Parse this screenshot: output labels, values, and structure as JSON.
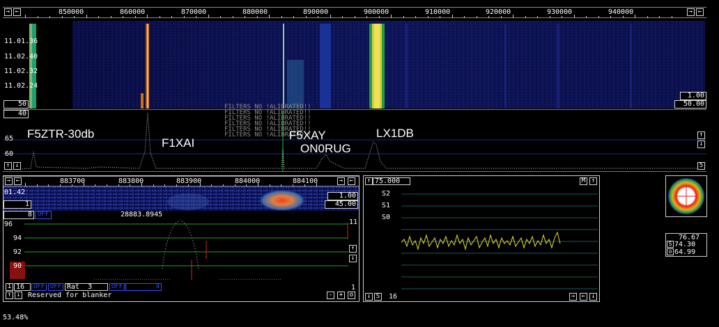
{
  "main_ruler": {
    "freqs": [
      "850000",
      "860000",
      "870000",
      "880000",
      "890000",
      "900000",
      "910000",
      "920000",
      "930000",
      "940000"
    ]
  },
  "waterfall": {
    "times": [
      "11.01.36",
      "11.02.40",
      "11.02.32",
      "11.02.24"
    ],
    "avg_box": "50",
    "gain_box": "1.00",
    "scale_box": "50.00",
    "filters_text": [
      "FILTERS NO",
      "FILTERS NO",
      "FILTERS NO",
      "FILTERS NO",
      "FILTERS NO",
      "FILTERS NO"
    ],
    "calib_text": [
      "!ALIBRATED!!",
      "!ALIBRATED!!",
      "!ALIBRATED!!",
      "!ALIBRATED!!",
      "!ALIBRATED!!",
      "!ALIBRATED!!"
    ]
  },
  "spectrum": {
    "top_box": "40",
    "ylabels": [
      "65",
      "60"
    ],
    "stations": [
      "F5ZTR-30db",
      "F1XAI",
      "F5XAY",
      "ON0RUG",
      "LX1DB"
    ],
    "side_box": "5"
  },
  "baseband": {
    "ruler_freqs": [
      "883700",
      "883800",
      "883900",
      "884000",
      "884100"
    ],
    "time_label": "01.42",
    "box_1": "1",
    "box_8": "8",
    "gain_box": "1.00",
    "scale_box": "45.00",
    "freq_readout": "28883.8945",
    "ylabels": [
      "96",
      "94",
      "92",
      "90"
    ],
    "right_top": "11",
    "right_bottom": "1",
    "ctrl_16": "16",
    "rat_label": "Rat",
    "rat_value": "3",
    "blue_labels": [
      "OFF",
      "OFF",
      "OFF",
      "OFF"
    ],
    "blue_4": "4",
    "reserved": "Reserved for blanker"
  },
  "smeter": {
    "top_value": "75.000",
    "m_button": "M",
    "rows": [
      "S2",
      "S1",
      "S0"
    ],
    "bottom_s": "S",
    "bottom_16": "16"
  },
  "readouts": {
    "a": "76.67",
    "s": "74.30",
    "o": "64.99"
  },
  "status": "53.48%"
}
